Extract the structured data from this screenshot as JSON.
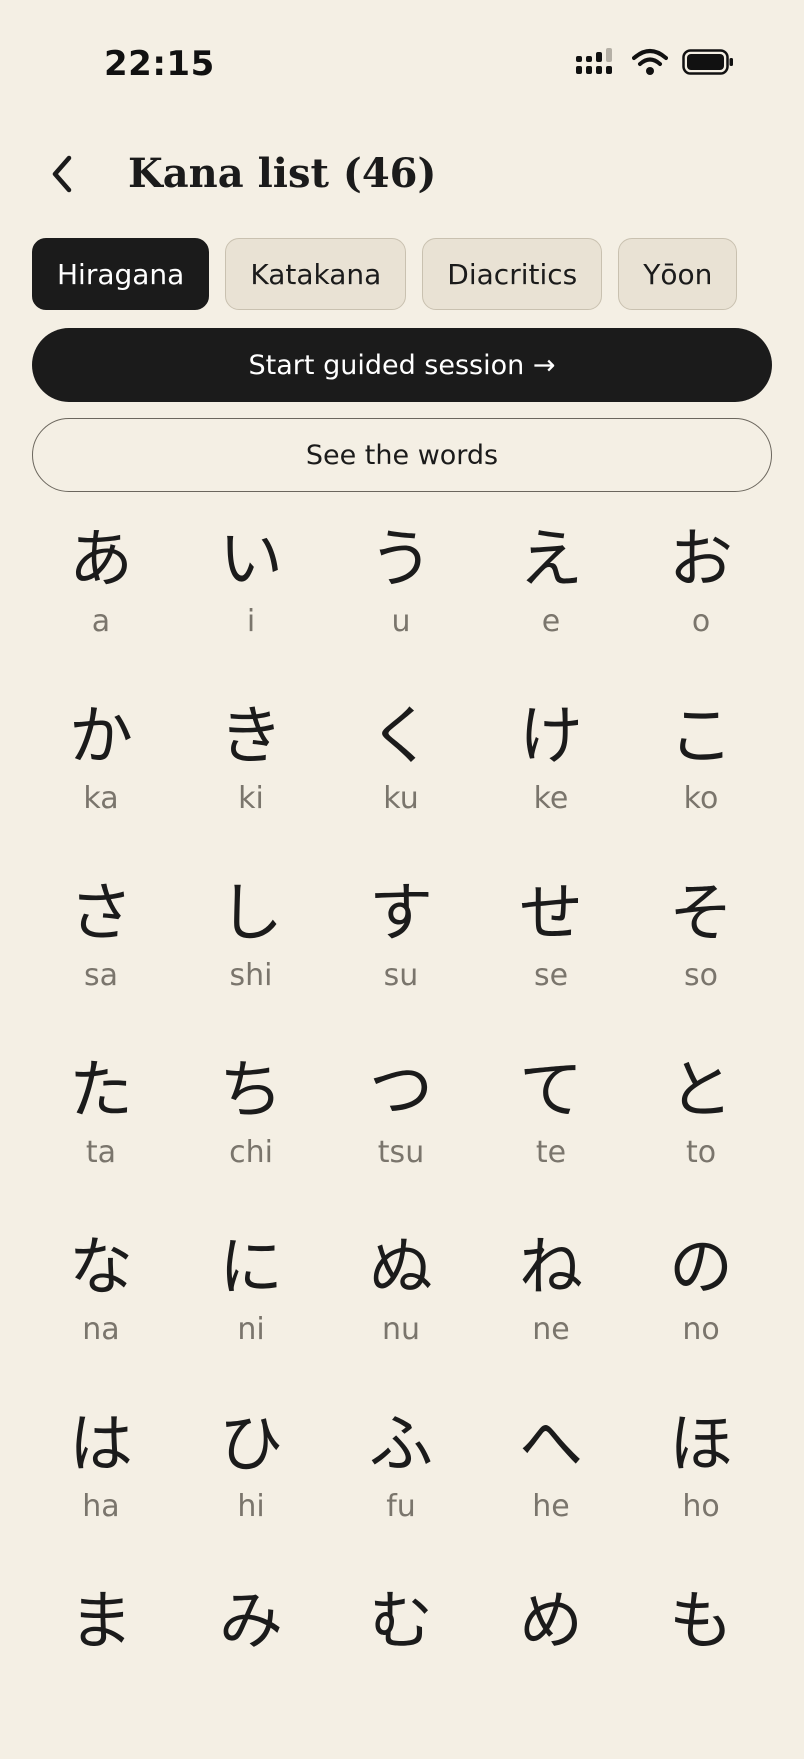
{
  "status_bar": {
    "time": "22:15",
    "icons": [
      "cellular-signal-icon",
      "wifi-icon",
      "battery-icon"
    ]
  },
  "header": {
    "back_icon": "chevron-left-icon",
    "title": "Kana list (46)"
  },
  "tabs": [
    {
      "label": "Hiragana",
      "active": true
    },
    {
      "label": "Katakana",
      "active": false
    },
    {
      "label": "Diacritics",
      "active": false
    },
    {
      "label": "Yōon",
      "active": false
    }
  ],
  "actions": {
    "primary_label": "Start guided session →",
    "secondary_label": "See the words"
  },
  "kana": [
    {
      "kana": "あ",
      "romaji": "a"
    },
    {
      "kana": "い",
      "romaji": "i"
    },
    {
      "kana": "う",
      "romaji": "u"
    },
    {
      "kana": "え",
      "romaji": "e"
    },
    {
      "kana": "お",
      "romaji": "o"
    },
    {
      "kana": "か",
      "romaji": "ka"
    },
    {
      "kana": "き",
      "romaji": "ki"
    },
    {
      "kana": "く",
      "romaji": "ku"
    },
    {
      "kana": "け",
      "romaji": "ke"
    },
    {
      "kana": "こ",
      "romaji": "ko"
    },
    {
      "kana": "さ",
      "romaji": "sa"
    },
    {
      "kana": "し",
      "romaji": "shi"
    },
    {
      "kana": "す",
      "romaji": "su"
    },
    {
      "kana": "せ",
      "romaji": "se"
    },
    {
      "kana": "そ",
      "romaji": "so"
    },
    {
      "kana": "た",
      "romaji": "ta"
    },
    {
      "kana": "ち",
      "romaji": "chi"
    },
    {
      "kana": "つ",
      "romaji": "tsu"
    },
    {
      "kana": "て",
      "romaji": "te"
    },
    {
      "kana": "と",
      "romaji": "to"
    },
    {
      "kana": "な",
      "romaji": "na"
    },
    {
      "kana": "に",
      "romaji": "ni"
    },
    {
      "kana": "ぬ",
      "romaji": "nu"
    },
    {
      "kana": "ね",
      "romaji": "ne"
    },
    {
      "kana": "の",
      "romaji": "no"
    },
    {
      "kana": "は",
      "romaji": "ha"
    },
    {
      "kana": "ひ",
      "romaji": "hi"
    },
    {
      "kana": "ふ",
      "romaji": "fu"
    },
    {
      "kana": "へ",
      "romaji": "he"
    },
    {
      "kana": "ほ",
      "romaji": "ho"
    },
    {
      "kana": "ま",
      "romaji": ""
    },
    {
      "kana": "み",
      "romaji": ""
    },
    {
      "kana": "む",
      "romaji": ""
    },
    {
      "kana": "め",
      "romaji": ""
    },
    {
      "kana": "も",
      "romaji": ""
    }
  ],
  "colors": {
    "background": "#f4efe4",
    "ink": "#1b1b1b",
    "romaji": "#7a756c",
    "tab_inactive": "#e9e2d4"
  }
}
